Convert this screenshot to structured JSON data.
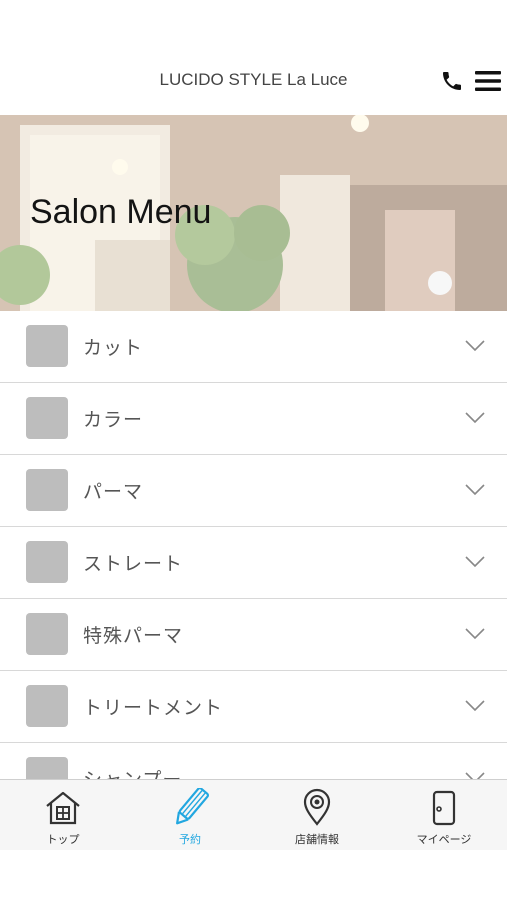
{
  "header": {
    "title": "LUCIDO STYLE La Luce",
    "phone_icon": "phone-icon",
    "menu_icon": "hamburger-icon"
  },
  "hero": {
    "title": "Salon Menu"
  },
  "menu": {
    "items": [
      {
        "label": "カット"
      },
      {
        "label": "カラー"
      },
      {
        "label": "パーマ"
      },
      {
        "label": "ストレート"
      },
      {
        "label": "特殊パーマ"
      },
      {
        "label": "トリートメント"
      },
      {
        "label": "シャンプー"
      }
    ]
  },
  "tabbar": {
    "active_color": "#22a7e0",
    "tabs": [
      {
        "label": "トップ",
        "icon": "home-icon"
      },
      {
        "label": "予約",
        "icon": "pencil-icon"
      },
      {
        "label": "店舗情報",
        "icon": "map-pin-icon"
      },
      {
        "label": "マイページ",
        "icon": "door-icon"
      }
    ]
  }
}
